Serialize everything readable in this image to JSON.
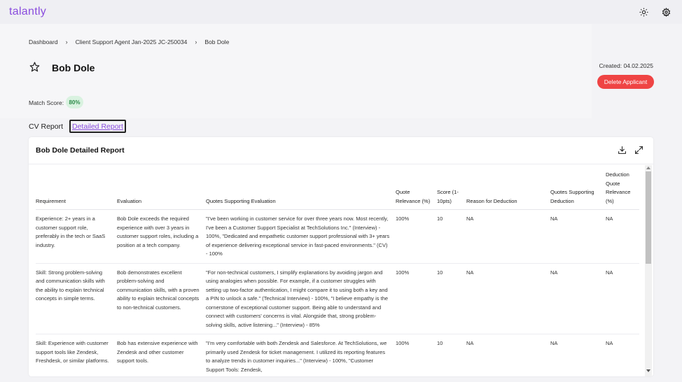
{
  "app": {
    "brand": "talantly"
  },
  "topbar": {
    "icons": [
      "sun-icon",
      "gear-icon"
    ]
  },
  "breadcrumb": [
    "Dashboard",
    "Client Support Agent Jan-2025 JC-250034",
    "Bob Dole"
  ],
  "applicant": {
    "name": "Bob Dole",
    "created": "Created: 04.02.2025",
    "delete_label": "Delete Applicant",
    "match_label": "Match Score:",
    "match_score": "80%"
  },
  "tabs": {
    "cv": "CV Report",
    "detailed": "Detailed Report"
  },
  "report": {
    "title": "Bob Dole Detailed Report",
    "columns": [
      "Requirement",
      "Evaluation",
      "Quotes Supporting Evaluation",
      "Quote Relevance (%)",
      "Score (1-10pts)",
      "Reason for Deduction",
      "Quotes Supporting Deduction",
      "Deduction Quote Relevance (%)"
    ],
    "rows": [
      {
        "requirement": "Experience: 2+ years in a customer support role, preferably in the tech or SaaS industry.",
        "evaluation": "Bob Dole exceeds the required experience with over 3 years in customer support roles, including a position at a tech company.",
        "quotes": "\"I've been working in customer service for over three years now. Most recently, I've been a Customer Support Specialist at TechSolutions Inc.\" (Interview) - 100%, \"Dedicated and empathetic customer support professional with 3+ years of experience delivering exceptional service in fast-paced environments.\" (CV) - 100%",
        "relevance": "100%",
        "score": "10",
        "reason": "NA",
        "deduction_quotes": "NA",
        "deduction_relevance": "NA"
      },
      {
        "requirement": "Skill: Strong problem-solving and communication skills with the ability to explain technical concepts in simple terms.",
        "evaluation": "Bob demonstrates excellent problem-solving and communication skills, with a proven ability to explain technical concepts to non-technical customers.",
        "quotes": "\"For non-technical customers, I simplify explanations by avoiding jargon and using analogies when possible. For example, if a customer struggles with setting up two-factor authentication, I might compare it to using both a key and a PIN to unlock a safe.\" (Technical Interview) - 100%, \"I believe empathy is the cornerstone of exceptional customer support. Being able to understand and connect with customers' concerns is vital. Alongside that, strong problem-solving skills, active listening...\" (Interview) - 85%",
        "relevance": "100%",
        "score": "10",
        "reason": "NA",
        "deduction_quotes": "NA",
        "deduction_relevance": "NA"
      },
      {
        "requirement": "Skill: Experience with customer support tools like Zendesk, Freshdesk, or similar platforms.",
        "evaluation": "Bob has extensive experience with Zendesk and other customer support tools.",
        "quotes": "\"I'm very comfortable with both Zendesk and Salesforce. At TechSolutions, we primarily used Zendesk for ticket management. I utilized its reporting features to analyze trends in customer inquiries...\" (Interview) - 100%, \"Customer Support Tools: Zendesk,",
        "relevance": "100%",
        "score": "10",
        "reason": "NA",
        "deduction_quotes": "NA",
        "deduction_relevance": "NA"
      }
    ]
  }
}
